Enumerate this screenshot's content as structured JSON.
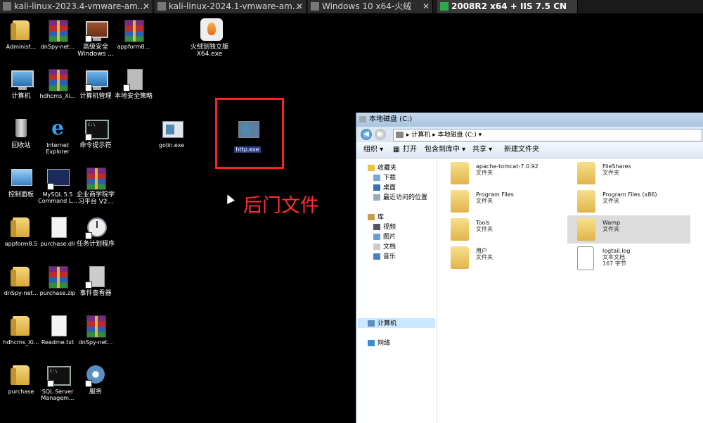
{
  "tabs": [
    {
      "label": "kali-linux-2023.4-vmware-am...",
      "close": "✕"
    },
    {
      "label": "kali-linux-2024.1-vmware-am...",
      "close": "✕"
    },
    {
      "label": "Windows 10 x64-火绒",
      "close": "✕"
    },
    {
      "label": "2008R2 x64 + IIS 7.5 CN",
      "close": ""
    }
  ],
  "desktop": {
    "icons": [
      {
        "label": "Administ...",
        "icon": "user-folder-icon"
      },
      {
        "label": "dnSpy-net...",
        "icon": "winrar-icon"
      },
      {
        "label": "高级安全\nWindows ...",
        "icon": "firewall-icon"
      },
      {
        "label": "appform8...",
        "icon": "winrar-icon"
      },
      {
        "label": "火绒剑独立版\nX64.exe",
        "icon": "huorong-icon"
      },
      {
        "label": "计算机",
        "icon": "computer-icon"
      },
      {
        "label": "hdhcms_Xi...",
        "icon": "winrar-icon"
      },
      {
        "label": "计算机管理",
        "icon": "computer-manage-icon"
      },
      {
        "label": "本地安全策略",
        "icon": "security-policy-icon"
      },
      {
        "label": "回收站",
        "icon": "recycle-bin-icon"
      },
      {
        "label": "Internet\nExplorer",
        "icon": "ie-icon"
      },
      {
        "label": "命令提示符",
        "icon": "cmd-icon"
      },
      {
        "label": "golin.exe",
        "icon": "exe-icon"
      },
      {
        "label": "http.exe",
        "icon": "exe-icon"
      },
      {
        "label": "控制面板",
        "icon": "control-panel-icon"
      },
      {
        "label": "MySQL 5.5\nCommand L...",
        "icon": "mysql-icon"
      },
      {
        "label": "企业商学院学\n习平台 V2...",
        "icon": "winrar-icon"
      },
      {
        "label": "appform8.5",
        "icon": "folder-icon"
      },
      {
        "label": "purchase.dll",
        "icon": "dll-icon"
      },
      {
        "label": "任务计划程序",
        "icon": "task-scheduler-icon"
      },
      {
        "label": "dnSpy-net...",
        "icon": "folder-icon"
      },
      {
        "label": "purchase.zip",
        "icon": "winrar-icon"
      },
      {
        "label": "事件查看器",
        "icon": "event-viewer-icon"
      },
      {
        "label": "hdhcms_Xi...",
        "icon": "folder-icon"
      },
      {
        "label": "Readme.txt",
        "icon": "text-file-icon"
      },
      {
        "label": "dnSpy-net...",
        "icon": "winrar-icon"
      },
      {
        "label": "purchase",
        "icon": "folder-icon"
      },
      {
        "label": "SQL Server\nManagem...",
        "icon": "sql-server-icon"
      },
      {
        "label": "服务",
        "icon": "services-icon"
      }
    ]
  },
  "annotation": {
    "text": "后门文件",
    "color": "#ff2020"
  },
  "explorer": {
    "title": "本地磁盘 (C:)",
    "address": "▸ 计算机 ▸ 本地磁盘 (C:) ▾",
    "back": "◀",
    "forward": "▶",
    "toolbar": {
      "organize": "组织 ▾",
      "open": "打开",
      "include": "包含到库中 ▾",
      "share": "共享 ▾",
      "new_folder": "新建文件夹"
    },
    "nav": {
      "favorites": "收藏夹",
      "downloads": "下载",
      "desktop": "桌面",
      "recent": "最近访问的位置",
      "libraries": "库",
      "videos": "视频",
      "pictures": "图片",
      "documents": "文档",
      "music": "音乐",
      "computer": "计算机",
      "network": "网络"
    },
    "files": [
      {
        "name": "apache-tomcat-7.0.92",
        "type": "文件夹",
        "size": ""
      },
      {
        "name": "FileShares",
        "type": "文件夹",
        "size": ""
      },
      {
        "name": "Program Files",
        "type": "文件夹",
        "size": ""
      },
      {
        "name": "Program Files (x86)",
        "type": "文件夹",
        "size": ""
      },
      {
        "name": "Tools",
        "type": "文件夹",
        "size": ""
      },
      {
        "name": "Wamp",
        "type": "文件夹",
        "size": ""
      },
      {
        "name": "用户",
        "type": "文件夹",
        "size": ""
      },
      {
        "name": "logtail.log",
        "type": "文本文档",
        "size": "167 字节"
      }
    ]
  }
}
